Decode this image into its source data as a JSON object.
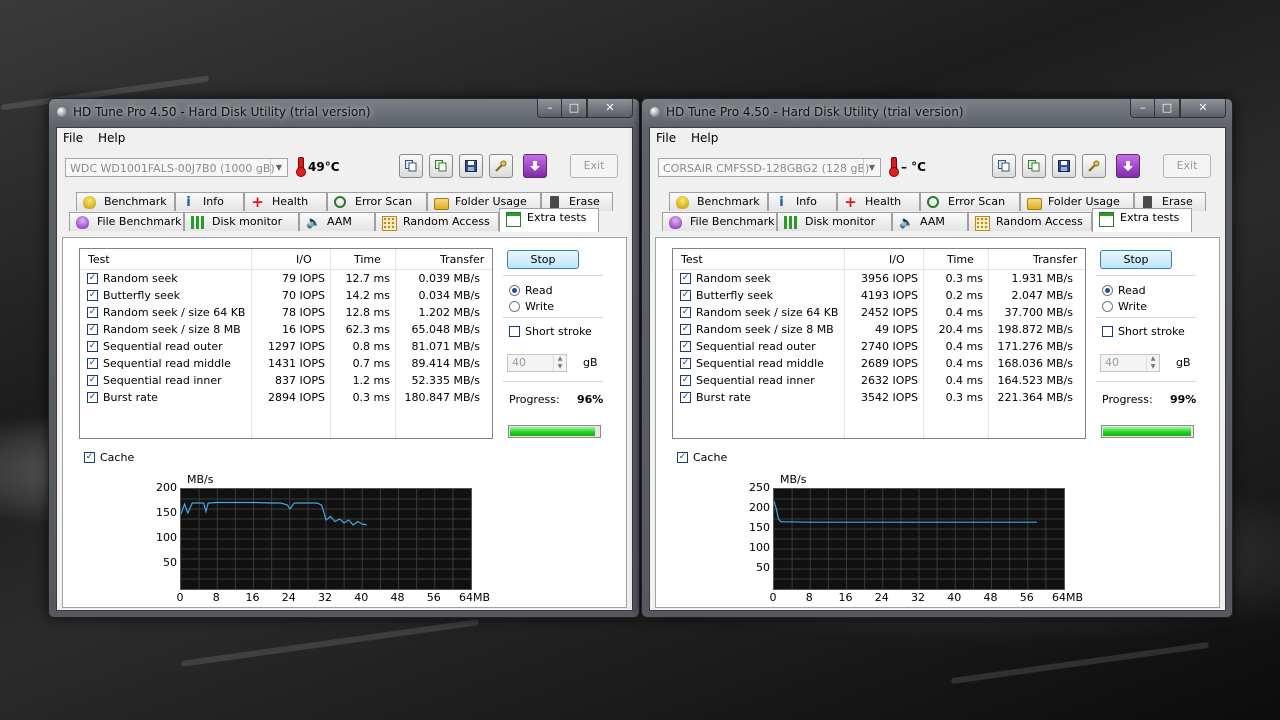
{
  "colors": {
    "accent": "#3399ff",
    "progress": "#1ecf1e",
    "trace": "#3fa9e0"
  },
  "windows": [
    {
      "title": "HD Tune Pro 4.50 - Hard Disk Utility (trial version)",
      "menu": [
        "File",
        "Help"
      ],
      "drive": "WDC WD1001FALS-00J7B0 (1000 gB)",
      "temperature": "49°C",
      "exit_label": "Exit",
      "tabs_back": [
        "Benchmark",
        "Info",
        "Health",
        "Error Scan",
        "Folder Usage",
        "Erase"
      ],
      "tabs_front": [
        "File Benchmark",
        "Disk monitor",
        "AAM",
        "Random Access",
        "Extra tests"
      ],
      "table": {
        "headers": [
          "Test",
          "I/O",
          "Time",
          "Transfer"
        ],
        "rows": [
          [
            "Random seek",
            "79 IOPS",
            "12.7 ms",
            "0.039 MB/s"
          ],
          [
            "Butterfly seek",
            "70 IOPS",
            "14.2 ms",
            "0.034 MB/s"
          ],
          [
            "Random seek / size 64 KB",
            "78 IOPS",
            "12.8 ms",
            "1.202 MB/s"
          ],
          [
            "Random seek / size 8 MB",
            "16 IOPS",
            "62.3 ms",
            "65.048 MB/s"
          ],
          [
            "Sequential read outer",
            "1297 IOPS",
            "0.8 ms",
            "81.071 MB/s"
          ],
          [
            "Sequential read middle",
            "1431 IOPS",
            "0.7 ms",
            "89.414 MB/s"
          ],
          [
            "Sequential read inner",
            "837 IOPS",
            "1.2 ms",
            "52.335 MB/s"
          ],
          [
            "Burst rate",
            "2894 IOPS",
            "0.3 ms",
            "180.847 MB/s"
          ]
        ]
      },
      "stop_label": "Stop",
      "read_label": "Read",
      "write_label": "Write",
      "short_stroke_label": "Short stroke",
      "short_stroke_value": "40",
      "gb_label": "gB",
      "progress_label": "Progress:",
      "progress_value": "96%",
      "progress_fraction": 0.96,
      "cache_label": "Cache",
      "graph": {
        "unit": "MB/s",
        "y_ticks": [
          "200",
          "150",
          "100",
          "50"
        ],
        "y_max": 200,
        "x_ticks": [
          "0",
          "8",
          "16",
          "24",
          "32",
          "40",
          "48",
          "56",
          "64MB"
        ],
        "x_max": 64
      }
    },
    {
      "title": "HD Tune Pro 4.50 - Hard Disk Utility (trial version)",
      "menu": [
        "File",
        "Help"
      ],
      "drive": "CORSAIR CMFSSD-128GBG2 (128 gB)",
      "temperature": "– °C",
      "exit_label": "Exit",
      "tabs_back": [
        "Benchmark",
        "Info",
        "Health",
        "Error Scan",
        "Folder Usage",
        "Erase"
      ],
      "tabs_front": [
        "File Benchmark",
        "Disk monitor",
        "AAM",
        "Random Access",
        "Extra tests"
      ],
      "table": {
        "headers": [
          "Test",
          "I/O",
          "Time",
          "Transfer"
        ],
        "rows": [
          [
            "Random seek",
            "3956 IOPS",
            "0.3 ms",
            "1.931 MB/s"
          ],
          [
            "Butterfly seek",
            "4193 IOPS",
            "0.2 ms",
            "2.047 MB/s"
          ],
          [
            "Random seek / size 64 KB",
            "2452 IOPS",
            "0.4 ms",
            "37.700 MB/s"
          ],
          [
            "Random seek / size 8 MB",
            "49 IOPS",
            "20.4 ms",
            "198.872 MB/s"
          ],
          [
            "Sequential read outer",
            "2740 IOPS",
            "0.4 ms",
            "171.276 MB/s"
          ],
          [
            "Sequential read middle",
            "2689 IOPS",
            "0.4 ms",
            "168.036 MB/s"
          ],
          [
            "Sequential read inner",
            "2632 IOPS",
            "0.4 ms",
            "164.523 MB/s"
          ],
          [
            "Burst rate",
            "3542 IOPS",
            "0.3 ms",
            "221.364 MB/s"
          ]
        ]
      },
      "stop_label": "Stop",
      "read_label": "Read",
      "write_label": "Write",
      "short_stroke_label": "Short stroke",
      "short_stroke_value": "40",
      "gb_label": "gB",
      "progress_label": "Progress:",
      "progress_value": "99%",
      "progress_fraction": 0.99,
      "cache_label": "Cache",
      "graph": {
        "unit": "MB/s",
        "y_ticks": [
          "250",
          "200",
          "150",
          "100",
          "50"
        ],
        "y_max": 250,
        "x_ticks": [
          "0",
          "8",
          "16",
          "24",
          "32",
          "40",
          "48",
          "56",
          "64MB"
        ],
        "x_max": 64
      }
    }
  ],
  "chart_data": [
    {
      "type": "line",
      "xlabel": "MB",
      "ylabel": "MB/s",
      "xlim": [
        0,
        64
      ],
      "ylim": [
        0,
        200
      ],
      "x_ticks": [
        0,
        8,
        16,
        24,
        32,
        40,
        48,
        56,
        64
      ],
      "y_ticks": [
        50,
        100,
        150,
        200
      ],
      "grid": true,
      "series": [
        {
          "x": [
            0,
            0.8,
            1.5,
            2.5,
            5,
            5.5,
            6,
            8,
            12,
            16,
            20,
            22,
            23.5,
            24,
            25,
            28,
            30,
            31,
            31.5,
            32,
            33,
            34,
            35,
            36,
            37,
            38,
            39,
            40,
            41
          ],
          "y": [
            150,
            170,
            152,
            172,
            172,
            155,
            172,
            173,
            173,
            173,
            172,
            172,
            168,
            160,
            172,
            172,
            172,
            168,
            155,
            138,
            145,
            135,
            140,
            132,
            138,
            128,
            135,
            130,
            128
          ]
        }
      ]
    },
    {
      "type": "line",
      "xlabel": "MB",
      "ylabel": "MB/s",
      "xlim": [
        0,
        64
      ],
      "ylim": [
        0,
        250
      ],
      "x_ticks": [
        0,
        8,
        16,
        24,
        32,
        40,
        48,
        56,
        64
      ],
      "y_ticks": [
        50,
        100,
        150,
        200,
        250
      ],
      "grid": true,
      "series": [
        {
          "x": [
            0,
            0.5,
            1,
            1.5,
            3,
            8,
            16,
            24,
            32,
            40,
            48,
            56,
            58
          ],
          "y": [
            220,
            200,
            175,
            168,
            168,
            167,
            167,
            167,
            167,
            167,
            167,
            167,
            167
          ]
        }
      ]
    }
  ]
}
